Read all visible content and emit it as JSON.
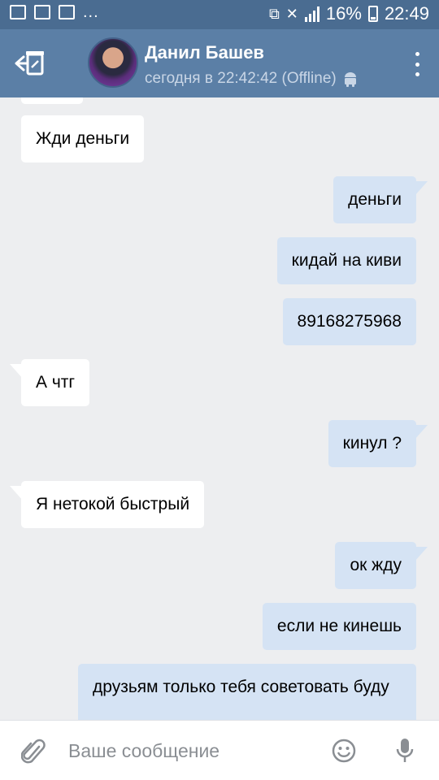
{
  "status_bar": {
    "dots": "...",
    "battery": "16%",
    "time": "22:49"
  },
  "header": {
    "contact_name": "Данил Башев",
    "last_seen": "сегодня в 22:42:42 (Offline)"
  },
  "messages": [
    {
      "direction": "in",
      "text": "Жди деньги"
    },
    {
      "direction": "out",
      "text": "деньги"
    },
    {
      "direction": "out",
      "text": "кидай на киви"
    },
    {
      "direction": "out",
      "text": "89168275968"
    },
    {
      "direction": "in",
      "text": "А чтг"
    },
    {
      "direction": "out",
      "text": "кинул ?"
    },
    {
      "direction": "in",
      "text": "Я нетокой быстрый"
    },
    {
      "direction": "out",
      "text": "ок жду"
    },
    {
      "direction": "out",
      "text": "если не кинешь"
    },
    {
      "direction": "out",
      "text": "друзьям только тебя советовать буду"
    }
  ],
  "composer": {
    "placeholder": "Ваше сообщение"
  },
  "icons": {
    "back": "back-to-dialogs-icon",
    "menu": "more-vertical-icon",
    "platform": "android-icon",
    "attach": "paperclip-icon",
    "emoji": "smiley-icon",
    "mic": "microphone-icon"
  },
  "colors": {
    "header": "#5b7fa6",
    "status_bar": "#4a6c91",
    "chat_background": "#edeef0",
    "incoming_bubble": "#ffffff",
    "outgoing_bubble": "#d5e3f4"
  }
}
